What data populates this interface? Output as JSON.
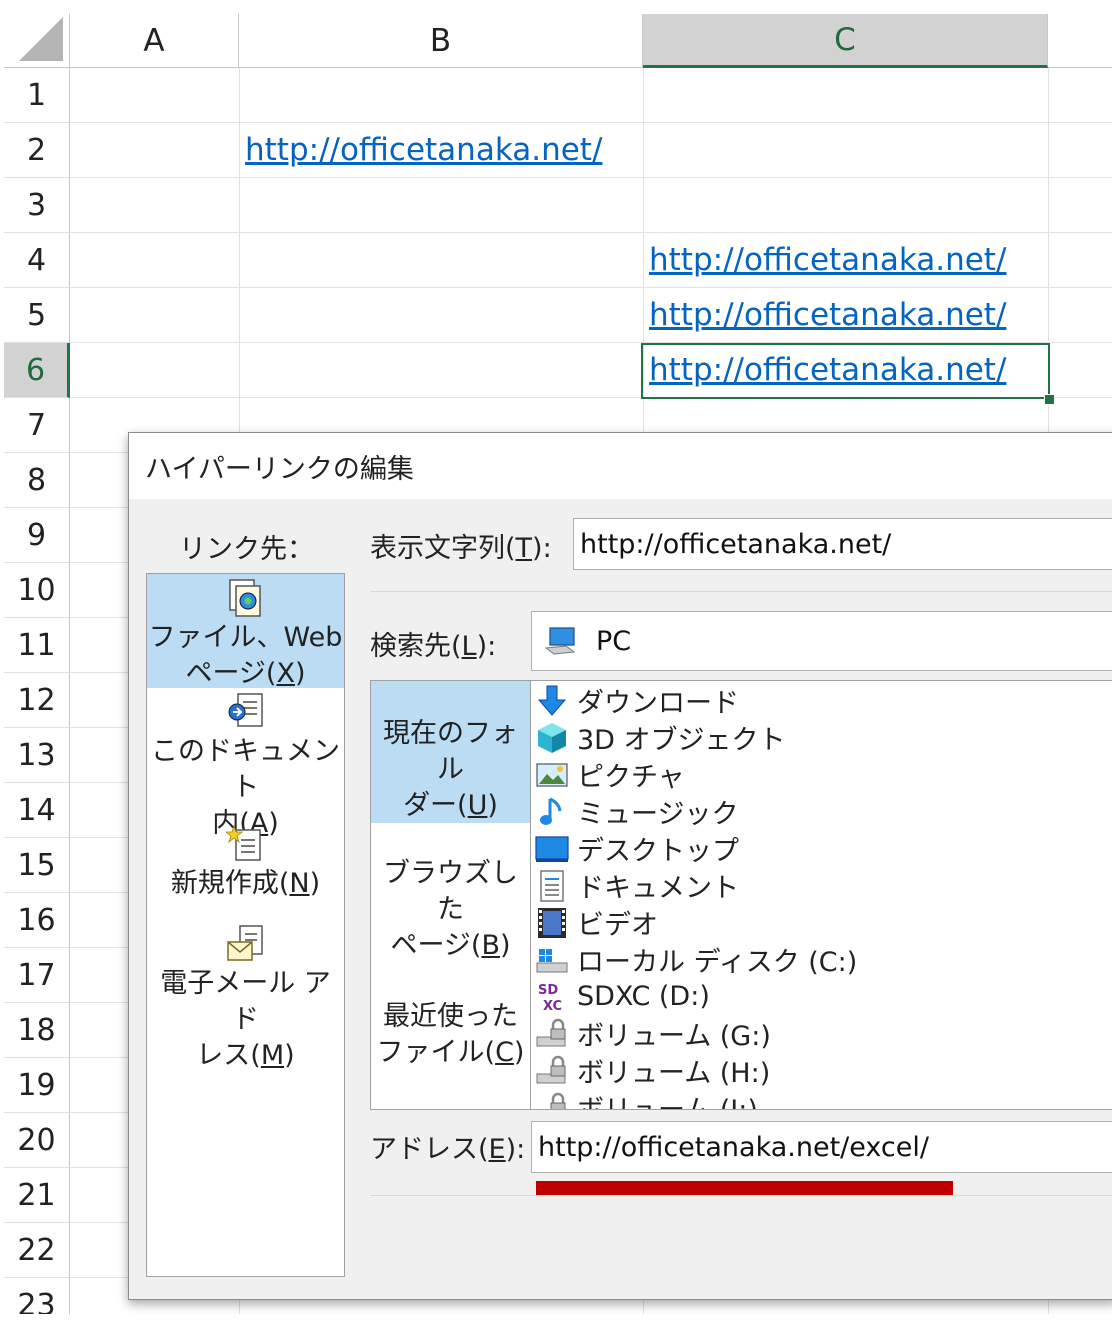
{
  "spreadsheet": {
    "columns": [
      "A",
      "B",
      "C"
    ],
    "selected_column": "C",
    "rows": [
      "1",
      "2",
      "3",
      "4",
      "5",
      "6",
      "7",
      "8",
      "9",
      "10",
      "11",
      "12",
      "13",
      "14",
      "15",
      "16",
      "17",
      "18",
      "19",
      "20",
      "21",
      "22",
      "23"
    ],
    "selected_row": "6",
    "cells": {
      "B2": "http://officetanaka.net/",
      "C4": "http://officetanaka.net/",
      "C5": "http://officetanaka.net/",
      "C6": "http://officetanaka.net/"
    },
    "link_color": "#0563c1",
    "selection_color": "#217346"
  },
  "dialog": {
    "title": "ハイパーリンクの編集",
    "link_to_label": "リンク先：",
    "link_to_items": [
      {
        "label_line1": "ファイル、Web",
        "label_line2_pre": "ページ(",
        "accel": "X",
        "label_line2_post": ")",
        "icon": "web-file-icon",
        "active": true
      },
      {
        "label_line1": "このドキュメント",
        "label_line2_pre": "内(",
        "accel": "A",
        "label_line2_post": ")",
        "icon": "document-place-icon",
        "active": false
      },
      {
        "label_line1": "",
        "label_line2_pre": "新規作成(",
        "accel": "N",
        "label_line2_post": ")",
        "icon": "new-document-icon",
        "active": false
      },
      {
        "label_line1": "電子メール アド",
        "label_line2_pre": "レス(",
        "accel": "M",
        "label_line2_post": ")",
        "icon": "email-icon",
        "active": false
      }
    ],
    "display_text": {
      "label_pre": "表示文字列(",
      "accel": "T",
      "label_post": "):",
      "value": "http://officetanaka.net/"
    },
    "look_in": {
      "label_pre": "検索先(",
      "accel": "L",
      "label_post": "):",
      "value": "PC",
      "icon": "computer-icon"
    },
    "look_in_buttons": [
      {
        "line1": "現在のフォル",
        "line2_pre": "ダー(",
        "accel": "U",
        "line2_post": ")",
        "active": true
      },
      {
        "line1": "ブラウズした",
        "line2_pre": "ページ(",
        "accel": "B",
        "line2_post": ")",
        "active": false
      },
      {
        "line1": "最近使った",
        "line2_pre": "ファイル(",
        "accel": "C",
        "line2_post": ")",
        "active": false
      }
    ],
    "files": [
      {
        "name": "ダウンロード",
        "icon": "download-icon"
      },
      {
        "name": "3D オブジェクト",
        "icon": "3d-object-icon"
      },
      {
        "name": "ピクチャ",
        "icon": "pictures-icon"
      },
      {
        "name": "ミュージック",
        "icon": "music-icon"
      },
      {
        "name": "デスクトップ",
        "icon": "desktop-icon"
      },
      {
        "name": "ドキュメント",
        "icon": "documents-icon"
      },
      {
        "name": "ビデオ",
        "icon": "video-icon"
      },
      {
        "name": "ローカル ディスク (C:)",
        "icon": "local-disk-icon"
      },
      {
        "name": "SDXC (D:)",
        "icon": "sdxc-icon"
      },
      {
        "name": "ボリューム (G:)",
        "icon": "locked-drive-icon"
      },
      {
        "name": "ボリューム (H:)",
        "icon": "locked-drive-icon"
      },
      {
        "name": "ボリューム (I:)",
        "icon": "locked-drive-icon"
      }
    ],
    "address": {
      "label_pre": "アドレス(",
      "accel": "E",
      "label_post": "):",
      "value": "http://officetanaka.net/excel/"
    },
    "highlight_color": "#c00000",
    "active_item_color": "#bcdcf4"
  }
}
